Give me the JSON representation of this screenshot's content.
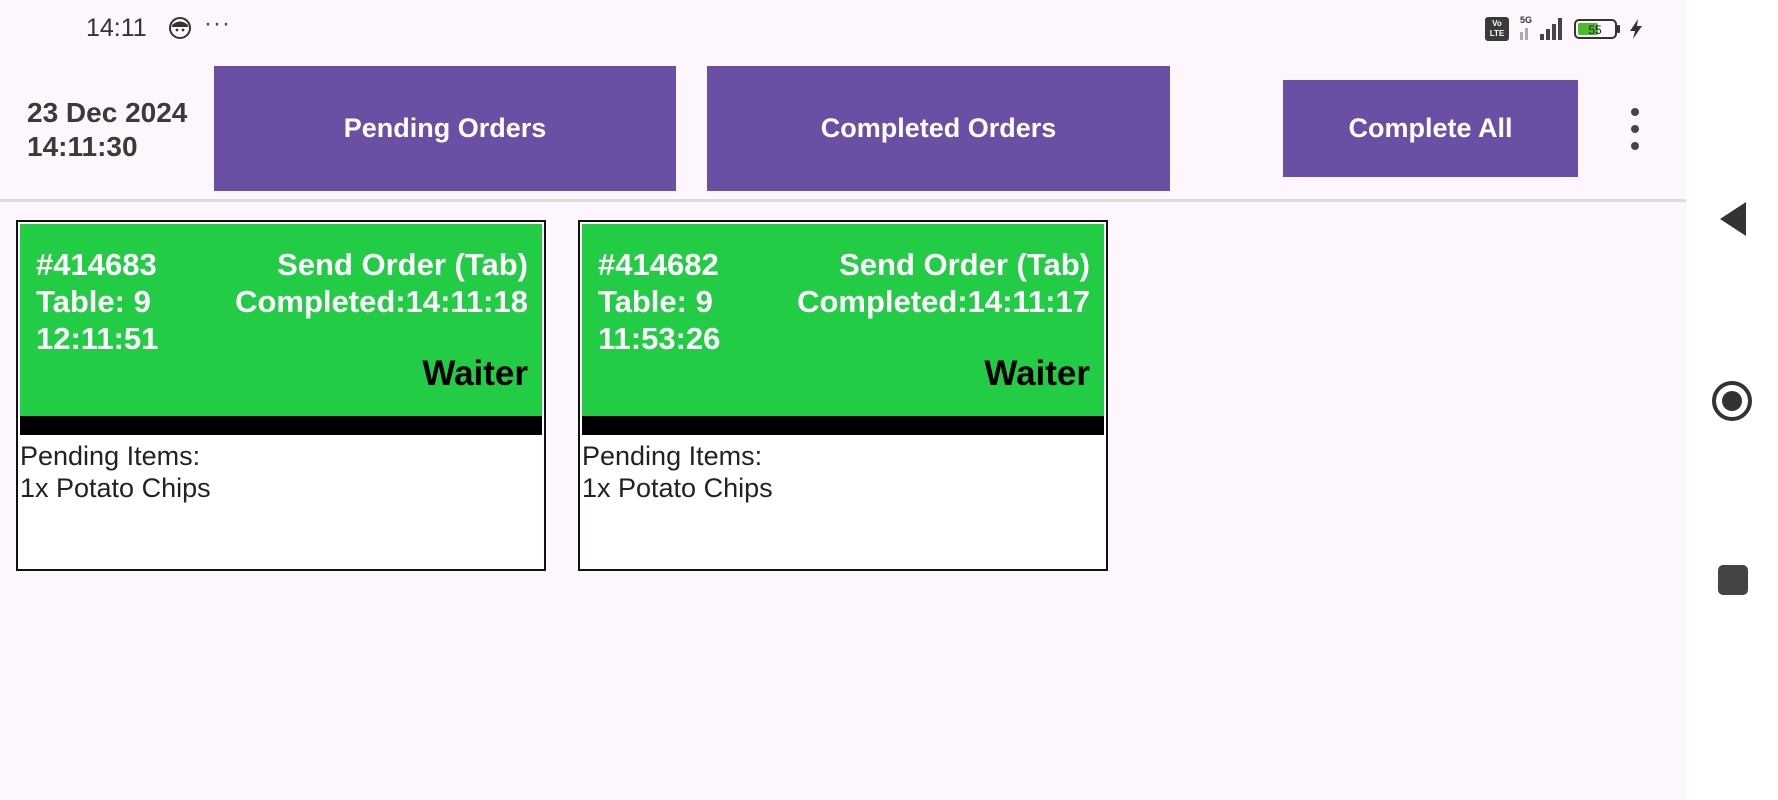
{
  "status_bar": {
    "time": "14:11",
    "dots": "···",
    "volte": "Vo LTE",
    "network": "5G",
    "battery_level": "55",
    "icons": [
      "face-icon",
      "volte-icon",
      "signal-icon",
      "battery-icon",
      "charging-icon"
    ]
  },
  "header": {
    "date": "23 Dec 2024",
    "time": "14:11:30",
    "pending_label": "Pending Orders",
    "completed_label": "Completed Orders",
    "complete_all_label": "Complete All",
    "button_color": "#6a4fa5"
  },
  "orders": [
    {
      "number": "#414683",
      "table": "Table: 9",
      "time": "12:11:51",
      "status": "Send Order (Tab)",
      "completed": "Completed:14:11:18",
      "role": "Waiter",
      "pending_label": "Pending Items:",
      "items": [
        "1x Potato Chips"
      ]
    },
    {
      "number": "#414682",
      "table": "Table: 9",
      "time": "11:53:26",
      "status": "Send Order (Tab)",
      "completed": "Completed:14:11:17",
      "role": "Waiter",
      "pending_label": "Pending Items:",
      "items": [
        "1x Potato Chips"
      ]
    }
  ],
  "colors": {
    "card_header": "#22cc44",
    "background": "#fdf7fd"
  },
  "nav": {
    "icons": [
      "back-icon",
      "home-icon",
      "recents-icon"
    ]
  }
}
